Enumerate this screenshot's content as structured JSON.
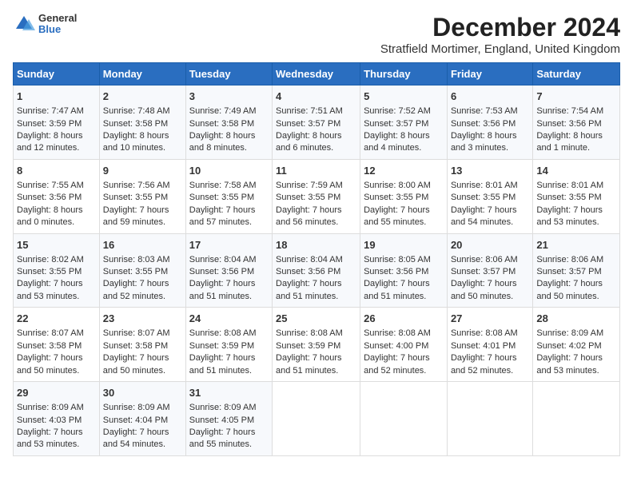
{
  "header": {
    "logo_general": "General",
    "logo_blue": "Blue",
    "month": "December 2024",
    "location": "Stratfield Mortimer, England, United Kingdom"
  },
  "days_of_week": [
    "Sunday",
    "Monday",
    "Tuesday",
    "Wednesday",
    "Thursday",
    "Friday",
    "Saturday"
  ],
  "weeks": [
    [
      {
        "day": "1",
        "info": "Sunrise: 7:47 AM\nSunset: 3:59 PM\nDaylight: 8 hours and 12 minutes."
      },
      {
        "day": "2",
        "info": "Sunrise: 7:48 AM\nSunset: 3:58 PM\nDaylight: 8 hours and 10 minutes."
      },
      {
        "day": "3",
        "info": "Sunrise: 7:49 AM\nSunset: 3:58 PM\nDaylight: 8 hours and 8 minutes."
      },
      {
        "day": "4",
        "info": "Sunrise: 7:51 AM\nSunset: 3:57 PM\nDaylight: 8 hours and 6 minutes."
      },
      {
        "day": "5",
        "info": "Sunrise: 7:52 AM\nSunset: 3:57 PM\nDaylight: 8 hours and 4 minutes."
      },
      {
        "day": "6",
        "info": "Sunrise: 7:53 AM\nSunset: 3:56 PM\nDaylight: 8 hours and 3 minutes."
      },
      {
        "day": "7",
        "info": "Sunrise: 7:54 AM\nSunset: 3:56 PM\nDaylight: 8 hours and 1 minute."
      }
    ],
    [
      {
        "day": "8",
        "info": "Sunrise: 7:55 AM\nSunset: 3:56 PM\nDaylight: 8 hours and 0 minutes."
      },
      {
        "day": "9",
        "info": "Sunrise: 7:56 AM\nSunset: 3:55 PM\nDaylight: 7 hours and 59 minutes."
      },
      {
        "day": "10",
        "info": "Sunrise: 7:58 AM\nSunset: 3:55 PM\nDaylight: 7 hours and 57 minutes."
      },
      {
        "day": "11",
        "info": "Sunrise: 7:59 AM\nSunset: 3:55 PM\nDaylight: 7 hours and 56 minutes."
      },
      {
        "day": "12",
        "info": "Sunrise: 8:00 AM\nSunset: 3:55 PM\nDaylight: 7 hours and 55 minutes."
      },
      {
        "day": "13",
        "info": "Sunrise: 8:01 AM\nSunset: 3:55 PM\nDaylight: 7 hours and 54 minutes."
      },
      {
        "day": "14",
        "info": "Sunrise: 8:01 AM\nSunset: 3:55 PM\nDaylight: 7 hours and 53 minutes."
      }
    ],
    [
      {
        "day": "15",
        "info": "Sunrise: 8:02 AM\nSunset: 3:55 PM\nDaylight: 7 hours and 53 minutes."
      },
      {
        "day": "16",
        "info": "Sunrise: 8:03 AM\nSunset: 3:55 PM\nDaylight: 7 hours and 52 minutes."
      },
      {
        "day": "17",
        "info": "Sunrise: 8:04 AM\nSunset: 3:56 PM\nDaylight: 7 hours and 51 minutes."
      },
      {
        "day": "18",
        "info": "Sunrise: 8:04 AM\nSunset: 3:56 PM\nDaylight: 7 hours and 51 minutes."
      },
      {
        "day": "19",
        "info": "Sunrise: 8:05 AM\nSunset: 3:56 PM\nDaylight: 7 hours and 51 minutes."
      },
      {
        "day": "20",
        "info": "Sunrise: 8:06 AM\nSunset: 3:57 PM\nDaylight: 7 hours and 50 minutes."
      },
      {
        "day": "21",
        "info": "Sunrise: 8:06 AM\nSunset: 3:57 PM\nDaylight: 7 hours and 50 minutes."
      }
    ],
    [
      {
        "day": "22",
        "info": "Sunrise: 8:07 AM\nSunset: 3:58 PM\nDaylight: 7 hours and 50 minutes."
      },
      {
        "day": "23",
        "info": "Sunrise: 8:07 AM\nSunset: 3:58 PM\nDaylight: 7 hours and 50 minutes."
      },
      {
        "day": "24",
        "info": "Sunrise: 8:08 AM\nSunset: 3:59 PM\nDaylight: 7 hours and 51 minutes."
      },
      {
        "day": "25",
        "info": "Sunrise: 8:08 AM\nSunset: 3:59 PM\nDaylight: 7 hours and 51 minutes."
      },
      {
        "day": "26",
        "info": "Sunrise: 8:08 AM\nSunset: 4:00 PM\nDaylight: 7 hours and 52 minutes."
      },
      {
        "day": "27",
        "info": "Sunrise: 8:08 AM\nSunset: 4:01 PM\nDaylight: 7 hours and 52 minutes."
      },
      {
        "day": "28",
        "info": "Sunrise: 8:09 AM\nSunset: 4:02 PM\nDaylight: 7 hours and 53 minutes."
      }
    ],
    [
      {
        "day": "29",
        "info": "Sunrise: 8:09 AM\nSunset: 4:03 PM\nDaylight: 7 hours and 53 minutes."
      },
      {
        "day": "30",
        "info": "Sunrise: 8:09 AM\nSunset: 4:04 PM\nDaylight: 7 hours and 54 minutes."
      },
      {
        "day": "31",
        "info": "Sunrise: 8:09 AM\nSunset: 4:05 PM\nDaylight: 7 hours and 55 minutes."
      },
      null,
      null,
      null,
      null
    ]
  ]
}
